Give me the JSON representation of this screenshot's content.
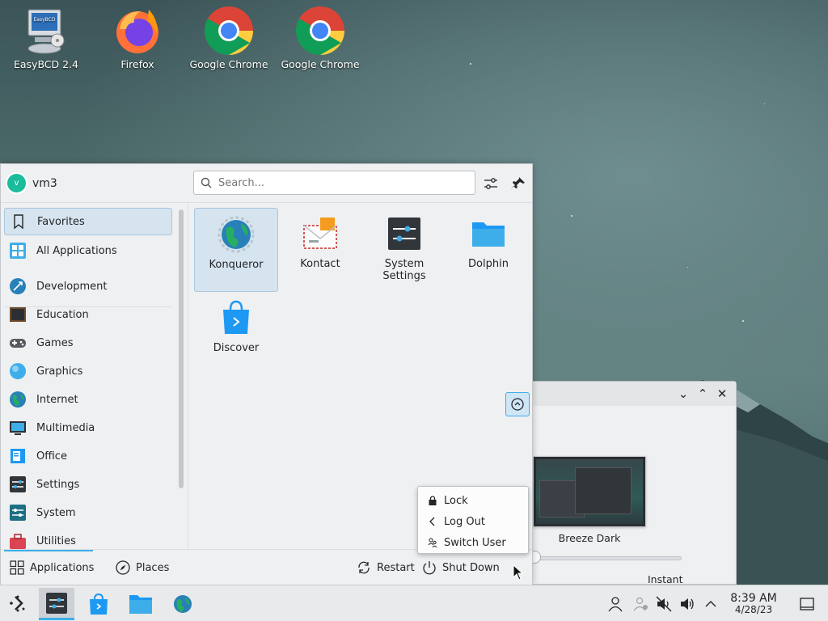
{
  "desktop": {
    "icons": [
      {
        "label": "EasyBCD 2.4",
        "icon": "easybcd-icon"
      },
      {
        "label": "Firefox",
        "icon": "firefox-icon"
      },
      {
        "label": "Google Chrome",
        "icon": "chrome-icon"
      },
      {
        "label": "Google Chrome",
        "icon": "chrome-icon"
      }
    ]
  },
  "background_window": {
    "controls": [
      "minimize",
      "maximize",
      "close"
    ],
    "theme_label": "Breeze Dark",
    "slider_label": "Instant"
  },
  "launcher": {
    "user": {
      "initial": "v",
      "name": "vm3"
    },
    "search": {
      "placeholder": "Search...",
      "value": ""
    },
    "sidebar": {
      "items": [
        {
          "label": "Favorites",
          "selected": true
        },
        {
          "label": "All Applications"
        },
        {
          "label": "Development"
        },
        {
          "label": "Education"
        },
        {
          "label": "Games"
        },
        {
          "label": "Graphics"
        },
        {
          "label": "Internet"
        },
        {
          "label": "Multimedia"
        },
        {
          "label": "Office"
        },
        {
          "label": "Settings"
        },
        {
          "label": "System"
        },
        {
          "label": "Utilities"
        }
      ]
    },
    "favorites": [
      {
        "label": "Konqueror",
        "selected": true
      },
      {
        "label": "Kontact"
      },
      {
        "label": "System Settings"
      },
      {
        "label": "Dolphin"
      },
      {
        "label": "Discover"
      }
    ],
    "footer": {
      "applications": "Applications",
      "places": "Places",
      "restart": "Restart",
      "shutdown": "Shut Down"
    }
  },
  "power_menu": {
    "items": [
      "Lock",
      "Log Out",
      "Switch User"
    ]
  },
  "taskbar": {
    "clock": {
      "time": "8:39 AM",
      "date": "4/28/23"
    },
    "accent": "#3daee9"
  }
}
